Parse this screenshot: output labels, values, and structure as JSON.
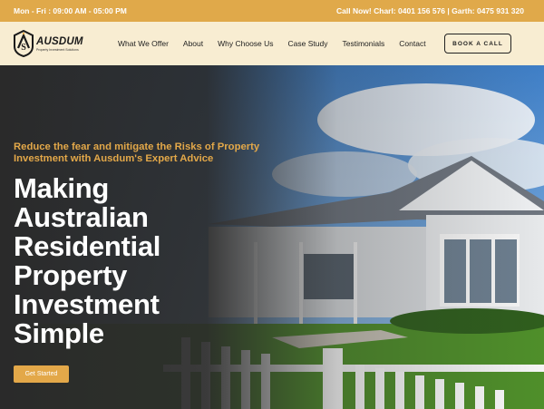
{
  "topbar": {
    "hours": "Mon - Fri : 09:00 AM - 05:00 PM",
    "call": "Call Now! Charl: 0401 156 576 | Garth: 0475 931 320"
  },
  "logo": {
    "name": "AUSDUM",
    "tagline": "Property Investment Solutions"
  },
  "nav": {
    "items": [
      "What We Offer",
      "About",
      "Why Choose Us",
      "Case Study",
      "Testimonials",
      "Contact"
    ],
    "cta": "BOOK A CALL"
  },
  "hero": {
    "subtitle": "Reduce the fear and mitigate the Risks of Property Investment with Ausdum's Expert Advice",
    "headline_lines": [
      "Making",
      "Australian",
      "Residential",
      "Property",
      "Investment",
      "Simple"
    ],
    "button": "Get Started"
  },
  "colors": {
    "accent": "#e3a849",
    "nav_bg": "#f8edd2",
    "topbar": "#e0a94a"
  }
}
